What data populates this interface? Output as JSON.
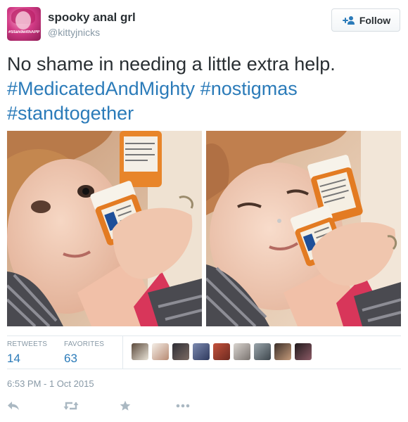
{
  "user": {
    "fullname": "spooky anal grl",
    "username": "@kittyjnicks",
    "avatar_tag": "#StandwithAPP"
  },
  "follow": {
    "label": "Follow",
    "icon": "add-person-icon"
  },
  "tweet": {
    "text": "No shame in needing a little extra help.",
    "hashtags": [
      "#MedicatedAndMighty",
      "#nostigmas",
      "#standtogether"
    ]
  },
  "stats": {
    "retweets_label": "RETWEETS",
    "retweets_count": "14",
    "favorites_label": "FAVORITES",
    "favorites_count": "63"
  },
  "favoriters_count_shown": 9,
  "timestamp": "6:53 PM - 1 Oct 2015",
  "actions": [
    {
      "name": "reply",
      "icon": "reply-icon"
    },
    {
      "name": "retweet",
      "icon": "retweet-icon"
    },
    {
      "name": "favorite",
      "icon": "star-icon"
    },
    {
      "name": "more",
      "icon": "more-icon"
    }
  ],
  "colors": {
    "text": "#292f33",
    "link": "#2b7bb9",
    "muted": "#8899a6",
    "border": "#e1e8ed",
    "action": "#aab8c2"
  }
}
